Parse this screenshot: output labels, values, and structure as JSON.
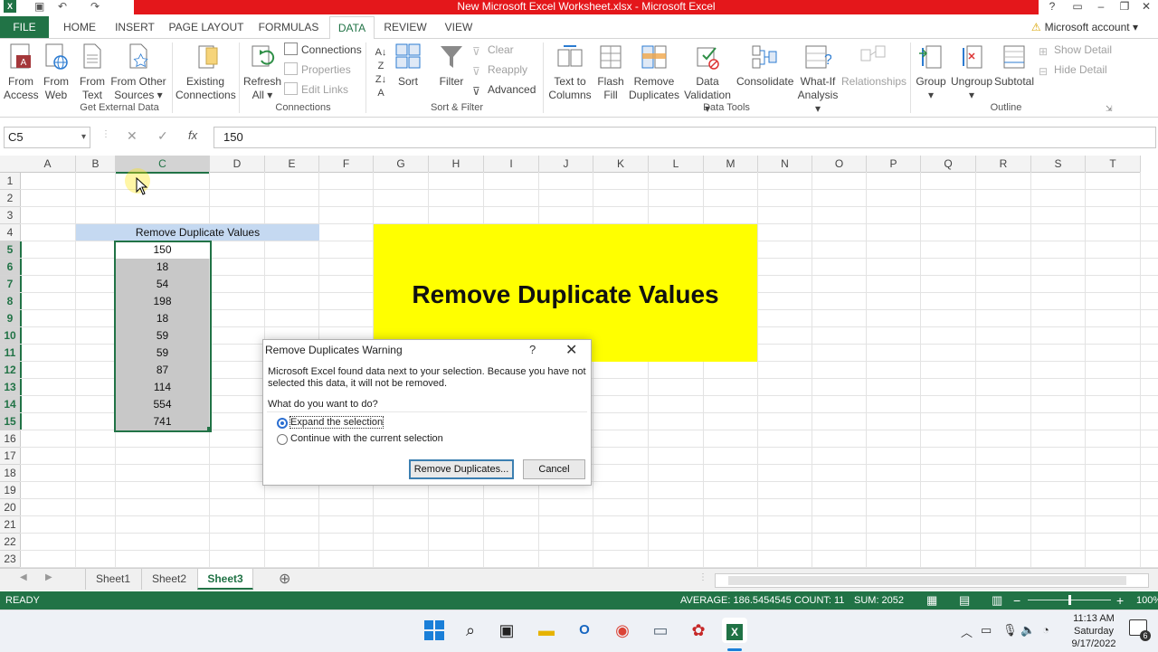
{
  "window": {
    "title": "New Microsoft Excel Worksheet.xlsx - Microsoft Excel",
    "help": "?",
    "minimize": "–",
    "restore": "❐",
    "close": "✕"
  },
  "ribbon_tabs": [
    "FILE",
    "HOME",
    "INSERT",
    "PAGE LAYOUT",
    "FORMULAS",
    "DATA",
    "REVIEW",
    "VIEW"
  ],
  "account": "Microsoft account",
  "ribbon": {
    "get_external": {
      "from_access": [
        "From",
        "Access"
      ],
      "from_web": [
        "From",
        "Web"
      ],
      "from_text": [
        "From",
        "Text"
      ],
      "from_other": [
        "From Other",
        "Sources ▾"
      ],
      "existing": [
        "Existing",
        "Connections"
      ],
      "label": "Get External Data"
    },
    "connections": {
      "refresh": [
        "Refresh",
        "All ▾"
      ],
      "connections": "Connections",
      "properties": "Properties",
      "edit_links": "Edit Links",
      "label": "Connections"
    },
    "sort_filter": {
      "sort": "Sort",
      "filter": "Filter",
      "clear": "Clear",
      "reapply": "Reapply",
      "advanced": "Advanced",
      "label": "Sort & Filter"
    },
    "data_tools": {
      "text_to_columns": [
        "Text to",
        "Columns"
      ],
      "flash_fill": [
        "Flash",
        "Fill"
      ],
      "remove_duplicates": [
        "Remove",
        "Duplicates"
      ],
      "data_validation": [
        "Data",
        "Validation ▾"
      ],
      "consolidate": "Consolidate",
      "what_if": [
        "What-If",
        "Analysis ▾"
      ],
      "relationships": "Relationships",
      "label": "Data Tools"
    },
    "outline": {
      "group": [
        "Group",
        "▾"
      ],
      "ungroup": [
        "Ungroup",
        "▾"
      ],
      "subtotal": "Subtotal",
      "show_detail": "Show Detail",
      "hide_detail": "Hide Detail",
      "label": "Outline"
    }
  },
  "formula_bar": {
    "name_box": "C5",
    "cancel": "✕",
    "enter": "✓",
    "fx": "fx",
    "value": "150"
  },
  "sheet": {
    "columns": [
      "A",
      "B",
      "C",
      "D",
      "E",
      "F",
      "G",
      "H",
      "I",
      "J",
      "K",
      "L",
      "M",
      "N",
      "O",
      "P",
      "Q",
      "R",
      "S",
      "T"
    ],
    "rows": [
      "1",
      "2",
      "3",
      "4",
      "5",
      "6",
      "7",
      "8",
      "9",
      "10",
      "11",
      "12",
      "13",
      "14",
      "15",
      "16",
      "17",
      "18",
      "19",
      "20",
      "21",
      "22",
      "23"
    ],
    "header_cell": "Remove Duplicate Values",
    "values": [
      "150",
      "18",
      "54",
      "198",
      "18",
      "59",
      "59",
      "87",
      "114",
      "554",
      "741"
    ],
    "banner_text": "Remove Duplicate Values"
  },
  "dialog": {
    "title": "Remove Duplicates Warning",
    "help": "?",
    "close": "✕",
    "message": "Microsoft Excel found data next to your selection. Because you have not selected this data, it will not be removed.",
    "question": "What do you want to do?",
    "option_expand": "Expand the selection",
    "option_continue": "Continue with the current selection",
    "selected_option": "Expand the selection",
    "remove_button": "Remove Duplicates...",
    "cancel_button": "Cancel"
  },
  "sheet_tabs": [
    "Sheet1",
    "Sheet2",
    "Sheet3"
  ],
  "active_sheet": "Sheet3",
  "add_sheet": "⊕",
  "status": {
    "ready": "READY",
    "average": "AVERAGE: 186.5454545",
    "count": "COUNT: 11",
    "sum": "SUM: 2052",
    "zoom_minus": "−",
    "zoom_plus": "+",
    "zoom_level": "100%"
  },
  "taskbar": {
    "time": "11:13 AM",
    "day": "Saturday",
    "date": "9/17/2022",
    "notification_count": "6"
  },
  "colors": {
    "excel_green": "#217346",
    "title_red": "#e4171b",
    "banner_yellow": "#ffff00",
    "header_fill": "#c5d9f1",
    "selection_fill": "#c8c8c8"
  }
}
